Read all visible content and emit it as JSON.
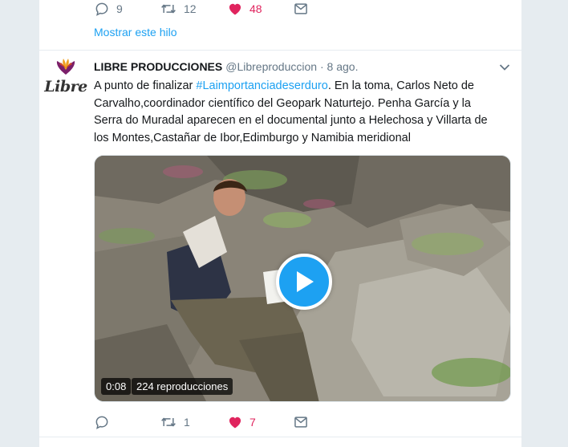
{
  "previous_tweet": {
    "actions": {
      "reply_count": "9",
      "retweet_count": "12",
      "like_count": "48"
    },
    "show_thread_label": "Mostrar este hilo"
  },
  "tweet": {
    "avatar_brand": "Libre",
    "author_name": "LIBRE PRODUCCIONES",
    "handle": "@Libreproduccion",
    "separator": "·",
    "time": "8 ago.",
    "text_before": "A punto de finalizar ",
    "hashtag": "#Laimportanciadeserduro",
    "text_after": ". En la toma, Carlos Neto de Carvalho,coordinador científico del Geopark Naturtejo. Penha García y la Serra do Muradal aparecen en el documental junto a Helechosa y Villarta de los Montes,Castañar de Ibor,Edimburgo y Namibia meridional",
    "video": {
      "duration": "0:08",
      "views": "224 reproducciones"
    },
    "actions": {
      "reply_count": "",
      "retweet_count": "1",
      "like_count": "7"
    }
  },
  "colors": {
    "accent": "#1da1f2",
    "like": "#e0245e",
    "muted": "#657786",
    "background": "#e6ecf0"
  },
  "icons": [
    "reply-icon",
    "retweet-icon",
    "heart-icon",
    "message-icon",
    "chevron-down-icon",
    "play-icon"
  ]
}
